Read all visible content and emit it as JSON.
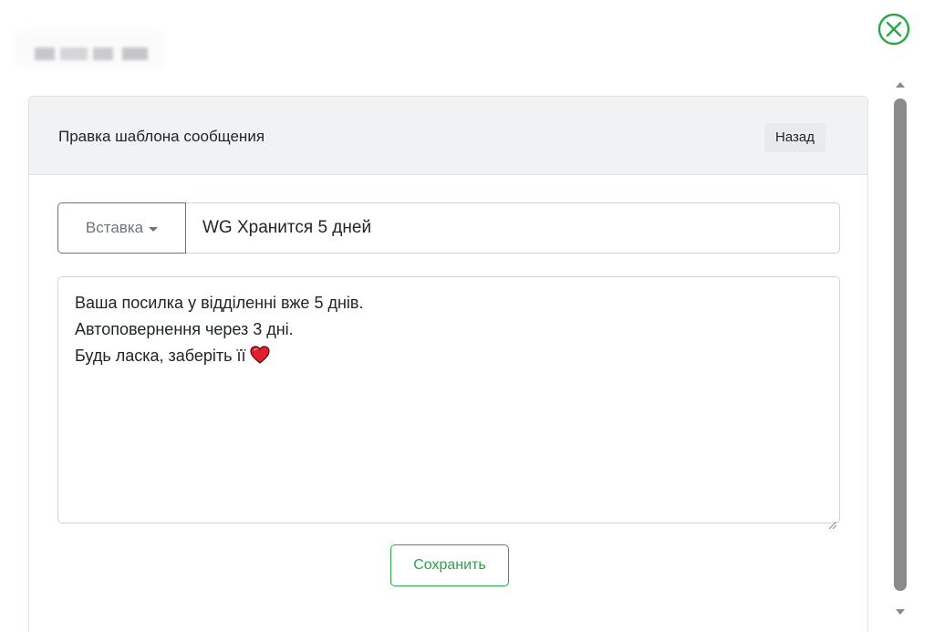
{
  "window": {
    "close_icon": "circle-x-icon",
    "close_color": "#28a745"
  },
  "card": {
    "title": "Правка шаблона сообщения",
    "back_label": "Назад"
  },
  "form": {
    "insert_label": "Вставка",
    "template_name": "WG Хранится 5 дней",
    "message_lines": [
      "Ваша посилка у відділенні вже 5 днів.",
      "Автоповернення через 3 дні.",
      "Будь ласка, заберіть її"
    ],
    "message_emoji": "heart-icon",
    "save_label": "Сохранить"
  },
  "colors": {
    "accent_green": "#28a745",
    "header_bg": "#f1f2f3",
    "heart_red": "#e0202e"
  }
}
